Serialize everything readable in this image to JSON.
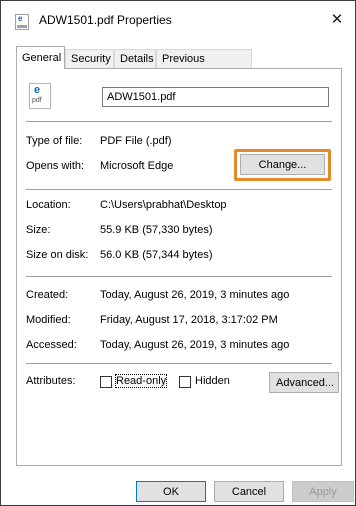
{
  "window": {
    "title": "ADW1501.pdf Properties",
    "close_glyph": "✕"
  },
  "tabs": [
    {
      "label": "General",
      "active": true
    },
    {
      "label": "Security",
      "active": false
    },
    {
      "label": "Details",
      "active": false
    },
    {
      "label": "Previous Versions",
      "active": false
    }
  ],
  "file": {
    "icon": "pdf-edge-file-icon",
    "icon_letter": "e",
    "icon_caption": "pdf",
    "name": "ADW1501.pdf"
  },
  "properties": {
    "type_label": "Type of file:",
    "type_value": "PDF File (.pdf)",
    "opens_label": "Opens with:",
    "opens_value": "Microsoft Edge",
    "change_button": "Change...",
    "location_label": "Location:",
    "location_value": "C:\\Users\\prabhat\\Desktop",
    "size_label": "Size:",
    "size_value": "55.9 KB (57,330 bytes)",
    "size_on_disk_label": "Size on disk:",
    "size_on_disk_value": "56.0 KB (57,344 bytes)",
    "created_label": "Created:",
    "created_value": "Today, August 26, 2019, 3 minutes ago",
    "modified_label": "Modified:",
    "modified_value": "Friday, August 17, 2018, 3:17:02 PM",
    "accessed_label": "Accessed:",
    "accessed_value": "Today, August 26, 2019, 3 minutes ago",
    "attributes_label": "Attributes:",
    "readonly_label": "Read-only",
    "hidden_label": "Hidden",
    "advanced_button": "Advanced..."
  },
  "footer": {
    "ok": "OK",
    "cancel": "Cancel",
    "apply": "Apply"
  },
  "colors": {
    "highlight": "#e8892a",
    "ok_border": "#0078d7"
  }
}
